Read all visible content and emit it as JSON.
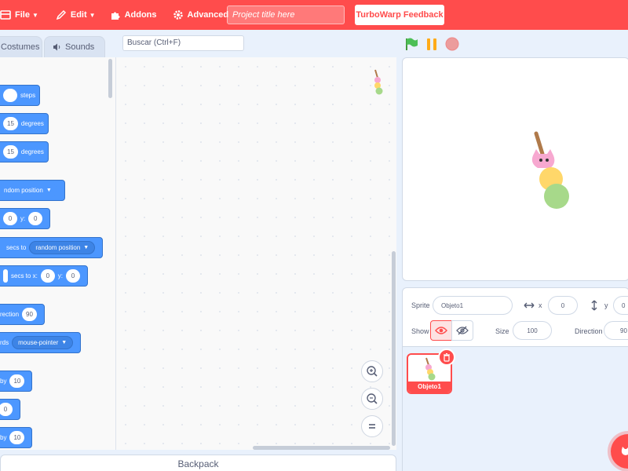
{
  "menubar": {
    "file_label": "File",
    "edit_label": "Edit",
    "addons_label": "Addons",
    "advanced_label": "Advanced",
    "project_title_placeholder": "Project title here",
    "feedback_label": "TurboWarp Feedback"
  },
  "tabs": {
    "costumes_label": "Costumes",
    "sounds_label": "Sounds"
  },
  "search": {
    "placeholder": "Buscar (Ctrl+F)"
  },
  "palette": {
    "blocks": [
      {
        "value": "",
        "suffix": "steps"
      },
      {
        "value": "15",
        "suffix": "degrees"
      },
      {
        "value": "15",
        "suffix": "degrees"
      },
      {
        "dropdown": "ndom position"
      },
      {
        "x_value": "0",
        "y_label": "y:",
        "y_value": "0"
      },
      {
        "prefix": "secs to",
        "dropdown": "random position"
      },
      {
        "prefix": "secs to x:",
        "x_value": "0",
        "y_label": "y:",
        "y_value": "0"
      },
      {
        "prefix": "rection",
        "value": "90"
      },
      {
        "prefix": "rds",
        "dropdown": "mouse-pointer"
      },
      {
        "prefix": "by",
        "value": "10"
      },
      {
        "value": "0"
      },
      {
        "prefix": "by",
        "value": "10"
      }
    ]
  },
  "backpack": {
    "label": "Backpack"
  },
  "sprite_info": {
    "sprite_label": "Sprite",
    "sprite_name": "Objeto1",
    "x_label": "x",
    "x_value": "0",
    "y_label": "y",
    "y_value": "0",
    "show_label": "Show",
    "size_label": "Size",
    "size_value": "100",
    "direction_label": "Direction",
    "direction_value": "90"
  },
  "sprite_list": {
    "sprites": [
      {
        "name": "Objeto1"
      }
    ]
  },
  "colors": {
    "accent": "#ff4c4c",
    "motion_block": "#4c97ff"
  },
  "icons": {
    "file": "file-icon",
    "edit": "edit-icon",
    "addons": "puzzle-icon",
    "advanced": "gear-icon",
    "green_flag": "green-flag-icon",
    "pause": "pause-icon",
    "stop": "stop-icon"
  }
}
